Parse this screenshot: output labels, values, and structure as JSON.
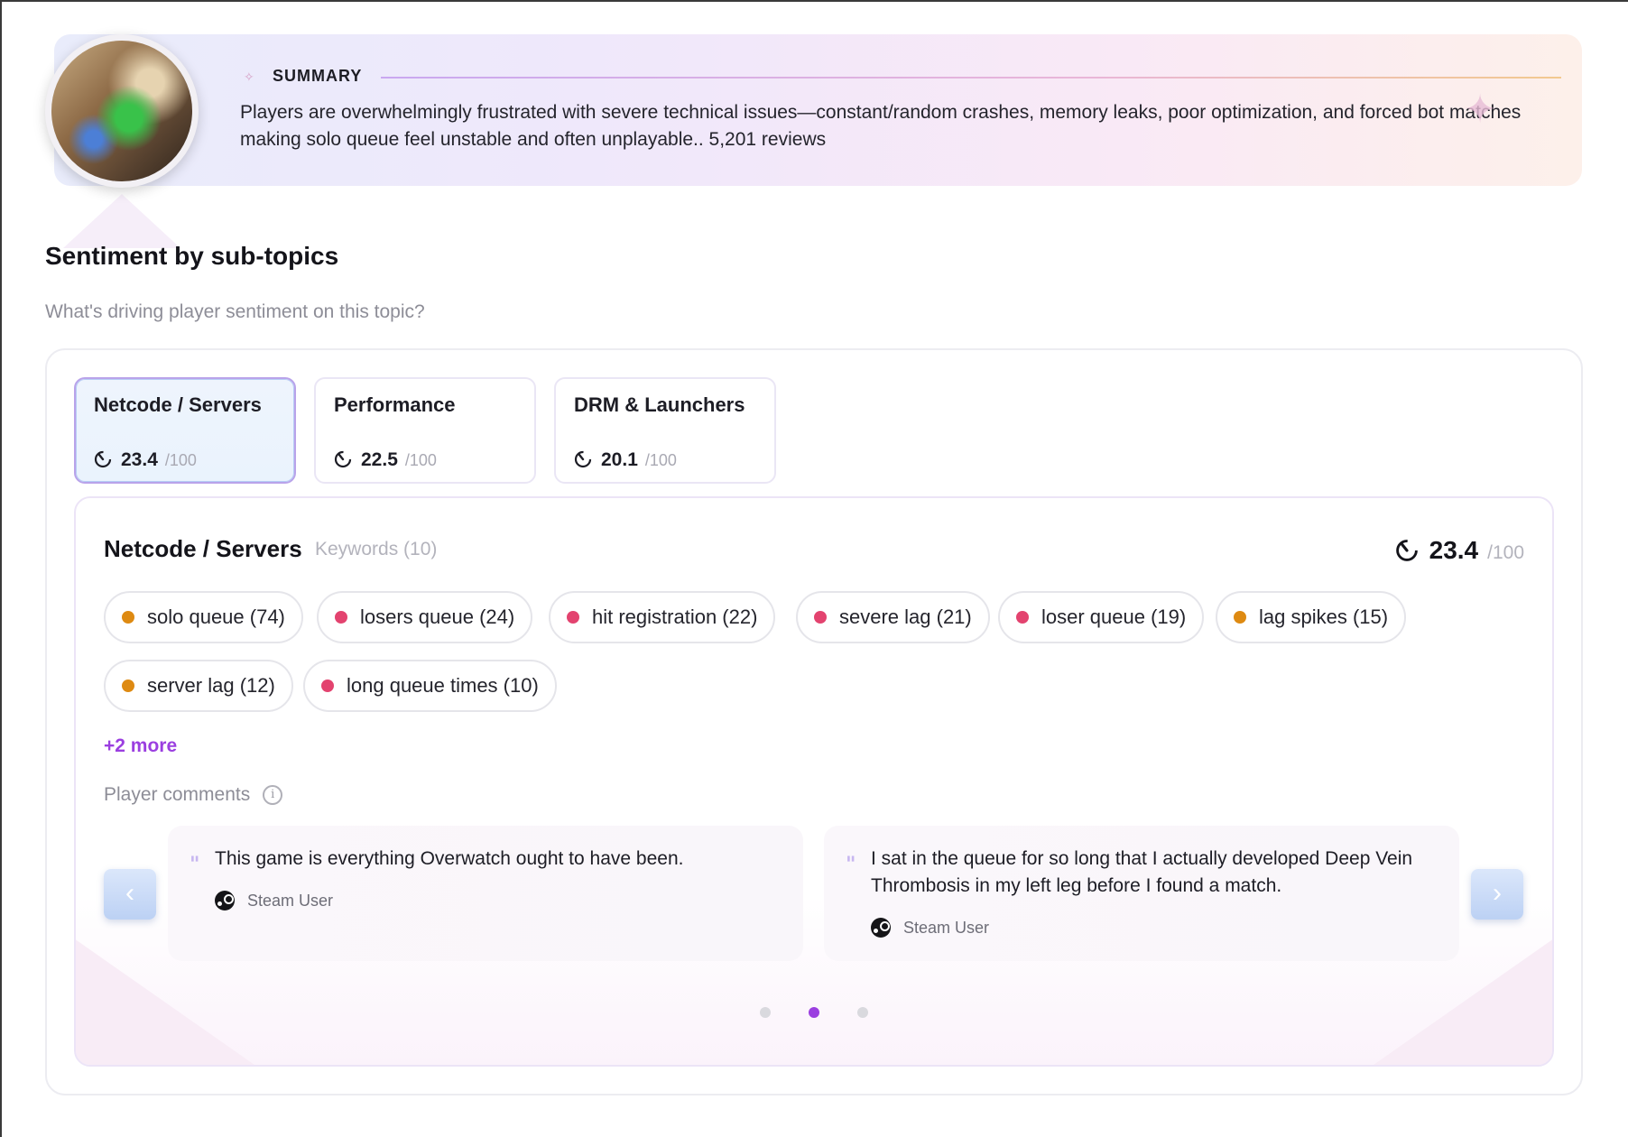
{
  "summary": {
    "title": "SUMMARY",
    "text": "Players are overwhelmingly frustrated with severe technical issues—constant/random crashes, memory leaks, poor optimization, and forced bot matches making solo queue feel unstable and often unplayable.. 5,201 reviews"
  },
  "section": {
    "title": "Sentiment by sub-topics",
    "subtitle": "What's driving player sentiment on this topic?"
  },
  "tabs": [
    {
      "name": "Netcode / Servers",
      "score": "23.4",
      "max": "/100",
      "active": true
    },
    {
      "name": "Performance",
      "score": "22.5",
      "max": "/100",
      "active": false
    },
    {
      "name": "DRM & Launchers",
      "score": "20.1",
      "max": "/100",
      "active": false
    }
  ],
  "detail": {
    "title": "Netcode / Servers",
    "keywords_label": "Keywords (10)",
    "score": "23.4",
    "max": "/100",
    "keywords": [
      {
        "label": "solo queue (74)",
        "tone": "orange"
      },
      {
        "label": "losers queue (24)",
        "tone": "pink"
      },
      {
        "label": "hit registration (22)",
        "tone": "pink"
      },
      {
        "label": "severe lag (21)",
        "tone": "pink"
      },
      {
        "label": "loser queue (19)",
        "tone": "pink"
      },
      {
        "label": "lag spikes (15)",
        "tone": "orange"
      },
      {
        "label": "server lag (12)",
        "tone": "orange"
      },
      {
        "label": "long queue times (10)",
        "tone": "pink"
      }
    ],
    "more_label": "+2 more",
    "comments_label": "Player comments",
    "comments": [
      {
        "text": "This game is everything Overwatch ought to have been.",
        "author": "Steam User"
      },
      {
        "text": "I sat in the queue for so long that I actually developed Deep Vein Thrombosis in my left leg before I found a match.",
        "author": "Steam User"
      }
    ],
    "pagination": {
      "pages": 3,
      "current": 2
    }
  },
  "icons": {
    "sparkle": "sparkle-icon",
    "gauge": "gauge-icon",
    "info": "info-icon",
    "quote": "quote-icon",
    "steam": "steam-icon",
    "prev": "chevron-left-icon",
    "next": "chevron-right-icon"
  },
  "colors": {
    "accent": "#9b3fe0",
    "negative": "#e3436f",
    "mixed": "#de8a12"
  }
}
